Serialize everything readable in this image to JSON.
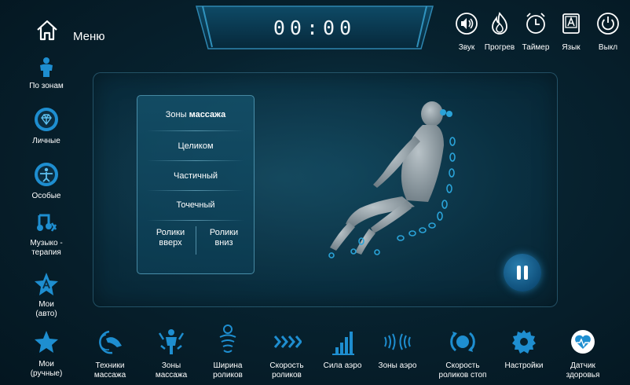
{
  "header": {
    "menu_label": "Меню",
    "timer": "00:00",
    "top_controls": [
      {
        "label": "Звук",
        "icon": "sound-icon"
      },
      {
        "label": "Прогрев",
        "icon": "heat-icon"
      },
      {
        "label": "Таймер",
        "icon": "alarm-clock-icon"
      },
      {
        "label": "Язык",
        "icon": "language-icon"
      },
      {
        "label": "Выкл",
        "icon": "power-icon"
      }
    ]
  },
  "sidebar": {
    "items": [
      {
        "label": "По зонам",
        "icon": "person-zones-icon"
      },
      {
        "label": "Личные",
        "icon": "diamond-badge-icon"
      },
      {
        "label": "Особые",
        "icon": "yoga-person-icon"
      },
      {
        "label": "Музыко - терапия",
        "icon": "music-notes-icon"
      },
      {
        "label": "Мои (авто)",
        "icon": "star-a-icon"
      },
      {
        "label": "Мои (ручные)",
        "icon": "star-icon"
      }
    ]
  },
  "zones_panel": {
    "title_prefix": "Зоны",
    "title_bold": "массажа",
    "options": [
      "Целиком",
      "Частичный",
      "Точечный"
    ],
    "rollers_up": "Ролики вверх",
    "rollers_down": "Ролики вниз"
  },
  "bottom_bar": {
    "items": [
      {
        "label": "Техники массажа",
        "icon": "massage-technique-icon"
      },
      {
        "label": "Зоны массажа",
        "icon": "body-zones-icon"
      },
      {
        "label": "Ширина роликов",
        "icon": "roller-width-icon"
      },
      {
        "label": "Скорость роликов",
        "icon": "roller-speed-icon"
      },
      {
        "label": "Сила аэро",
        "icon": "air-strength-icon"
      },
      {
        "label": "Зоны аэро",
        "icon": "air-zones-icon"
      },
      {
        "label": "Скорость роликов стоп",
        "icon": "foot-roller-speed-icon"
      },
      {
        "label": "Настройки",
        "icon": "gear-icon"
      },
      {
        "label": "Датчик здоровья",
        "icon": "heart-sensor-icon"
      }
    ]
  },
  "colors": {
    "accent": "#2f9fd6",
    "icon_blue": "#1e8ed0",
    "panel_border": "#78c8e6",
    "background": "#07222f"
  }
}
